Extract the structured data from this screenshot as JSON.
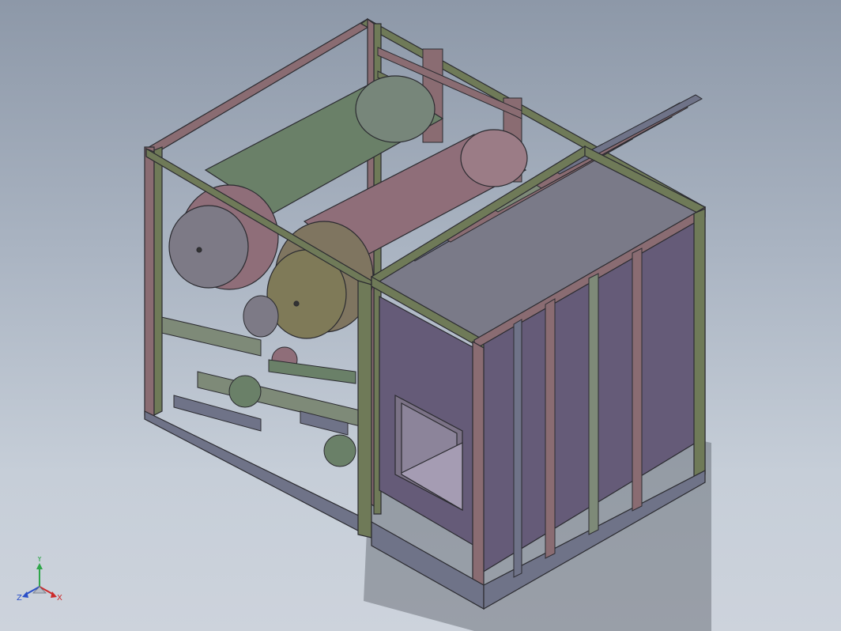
{
  "viewport": {
    "background_top": "#8d98a8",
    "background_bottom": "#cdd3dc"
  },
  "model": {
    "colors": {
      "frame_green": "#6f7a58",
      "frame_mauve": "#8a6c72",
      "frame_blue": "#6f7388",
      "tank_green": "#6a8068",
      "tank_mauve": "#8f6e79",
      "panel_purple": "#655b78",
      "flange": "#7d7a86",
      "pipe": "#7e8a78"
    }
  },
  "triad": {
    "y_label": "Y",
    "z_label": "Z",
    "x_label": "X",
    "y_color": "#2fa64a",
    "z_color": "#2a4fc8",
    "x_color": "#cc2a2a"
  }
}
